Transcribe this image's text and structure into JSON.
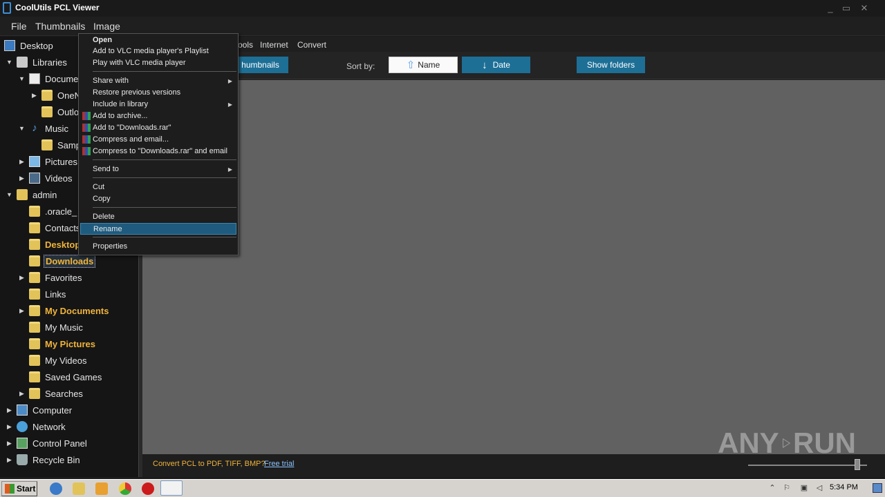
{
  "window": {
    "title": "CoolUtils PCL Viewer",
    "controls": [
      "_",
      "▭",
      "✕"
    ]
  },
  "menubar": {
    "items": [
      "File",
      "Thumbnails",
      "Image"
    ]
  },
  "tabs": [
    "Tools",
    "Internet",
    "Convert"
  ],
  "tabs_visible": [
    "ools",
    "Internet",
    "Convert"
  ],
  "toolbar": {
    "thumbnails_label": "humbnails",
    "sort_by_label": "Sort by:",
    "name_label": "Name",
    "date_label": "Date",
    "show_folders_label": "Show folders"
  },
  "tree": {
    "desktop": "Desktop",
    "libraries": "Libraries",
    "documents": "Docume",
    "onenote": "OneN",
    "outlook": "Outlo",
    "music": "Music",
    "sample": "Samp",
    "pictures": "Pictures",
    "videos": "Videos",
    "admin": "admin",
    "oracle": ".oracle_",
    "contacts": "Contacts",
    "desktop2": "Desktop",
    "downloads": "Downloads",
    "favorites": "Favorites",
    "links": "Links",
    "my_documents": "My Documents",
    "my_music": "My Music",
    "my_pictures": "My Pictures",
    "my_videos": "My Videos",
    "saved_games": "Saved Games",
    "searches": "Searches",
    "computer": "Computer",
    "network": "Network",
    "control_panel": "Control Panel",
    "recycle_bin": "Recycle Bin"
  },
  "context_menu": {
    "open": "Open",
    "vlc_playlist": "Add to VLC media player's Playlist",
    "vlc_play": "Play with VLC media player",
    "share_with": "Share with",
    "restore": "Restore previous versions",
    "include_library": "Include in library",
    "add_archive": "Add to archive...",
    "add_rar": "Add to \"Downloads.rar\"",
    "compress_email": "Compress and email...",
    "compress_rar_email": "Compress to \"Downloads.rar\" and email",
    "send_to": "Send to",
    "cut": "Cut",
    "copy": "Copy",
    "delete": "Delete",
    "rename": "Rename",
    "properties": "Properties"
  },
  "footer": {
    "promo": "Convert PCL to PDF, TIFF, BMP?",
    "trial_link": "Free trial"
  },
  "watermark": {
    "left": "ANY",
    "right": "RUN"
  },
  "taskbar": {
    "start_label": "Start",
    "clock": "5:34 PM"
  },
  "colors": {
    "accent": "#1d6f96",
    "highlight_text": "#f0b43c",
    "content_bg": "#616161"
  }
}
